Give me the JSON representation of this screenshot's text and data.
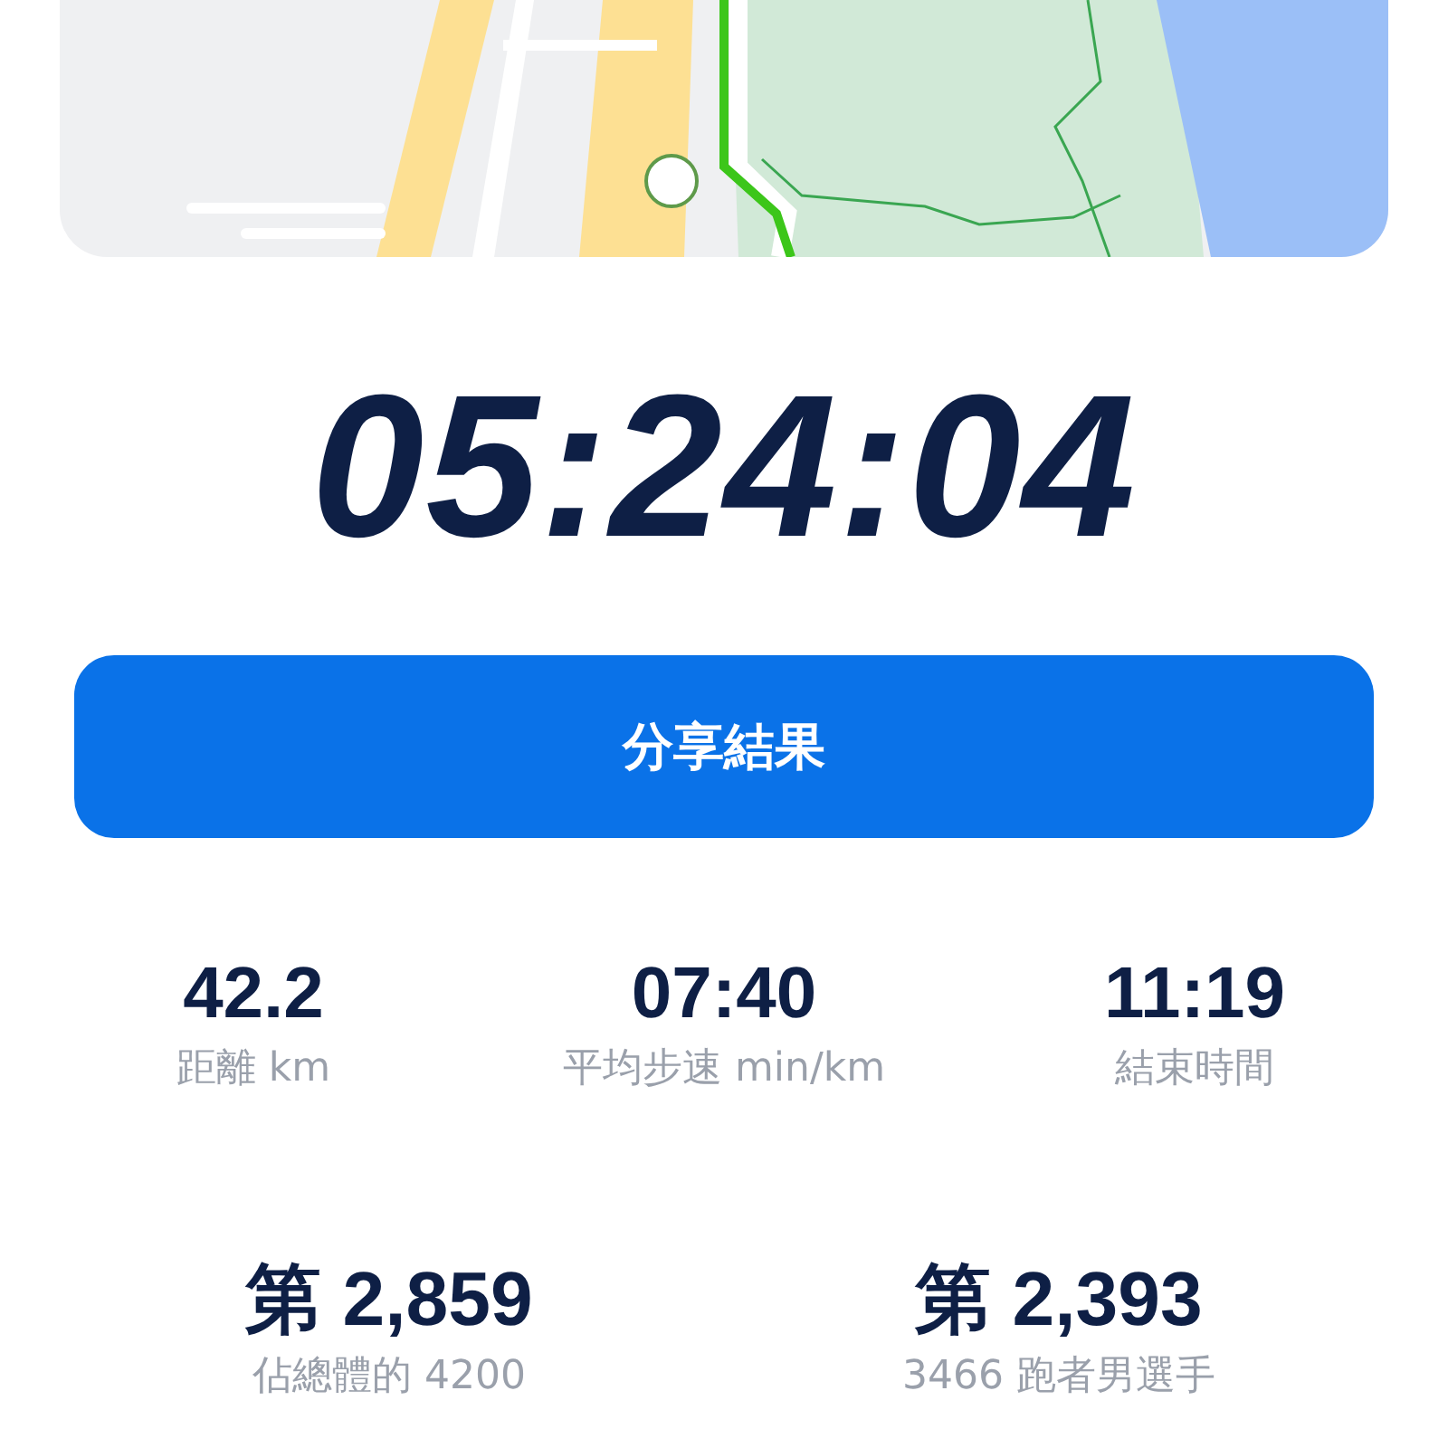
{
  "elapsed_time": "05:24:04",
  "share_button": {
    "label": "分享結果"
  },
  "stats": [
    {
      "value": "42.2",
      "label": "距離 km"
    },
    {
      "value": "07:40",
      "label": "平均步速 min/km"
    },
    {
      "value": "11:19",
      "label": "結束時間"
    }
  ],
  "rankings": [
    {
      "prefix": "第",
      "value": "2,859",
      "label": "佔總體的 4200"
    },
    {
      "prefix": "第",
      "value": "2,393",
      "label": "3466 跑者男選手"
    }
  ]
}
